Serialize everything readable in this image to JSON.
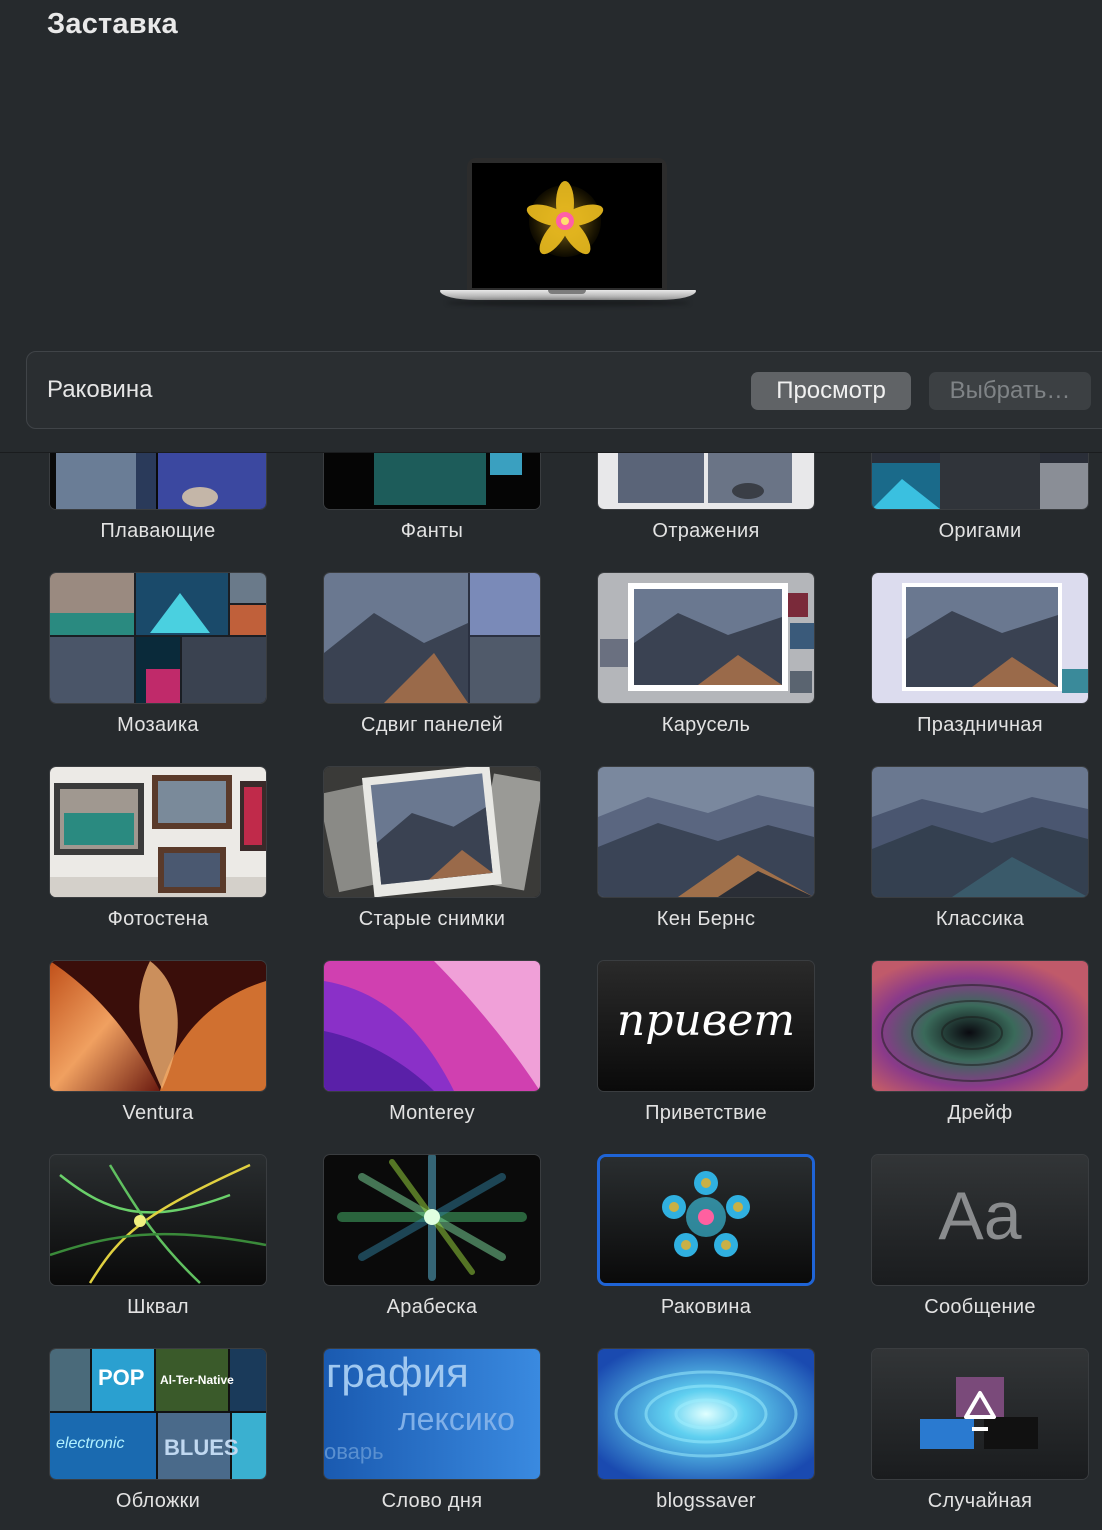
{
  "window": {
    "title": "Заставка"
  },
  "selected": {
    "name": "Раковина",
    "preview_label": "Просмотр",
    "choose_label": "Выбрать…"
  },
  "savers": [
    {
      "label": "Плавающие"
    },
    {
      "label": "Фанты"
    },
    {
      "label": "Отражения"
    },
    {
      "label": "Оригами"
    },
    {
      "label": "Мозаика"
    },
    {
      "label": "Сдвиг панелей"
    },
    {
      "label": "Карусель"
    },
    {
      "label": "Праздничная"
    },
    {
      "label": "Фотостена"
    },
    {
      "label": "Старые снимки"
    },
    {
      "label": "Кен Бернс"
    },
    {
      "label": "Классика"
    },
    {
      "label": "Ventura"
    },
    {
      "label": "Monterey"
    },
    {
      "label": "Приветствие",
      "thumb_text": "привет"
    },
    {
      "label": "Дрейф"
    },
    {
      "label": "Шквал"
    },
    {
      "label": "Арабеска"
    },
    {
      "label": "Раковина",
      "selected": true
    },
    {
      "label": "Сообщение",
      "thumb_text": "Aa"
    },
    {
      "label": "Обложки",
      "thumb_words": [
        "POP",
        "Al-Ter-Native",
        "electronic",
        "BLUES"
      ]
    },
    {
      "label": "Слово дня",
      "thumb_words": [
        "графия",
        "лексико",
        "оварь"
      ]
    },
    {
      "label": "blogssaver"
    },
    {
      "label": "Случайная"
    }
  ],
  "colors": {
    "selection": "#1f64d6",
    "background": "#262a2d"
  }
}
